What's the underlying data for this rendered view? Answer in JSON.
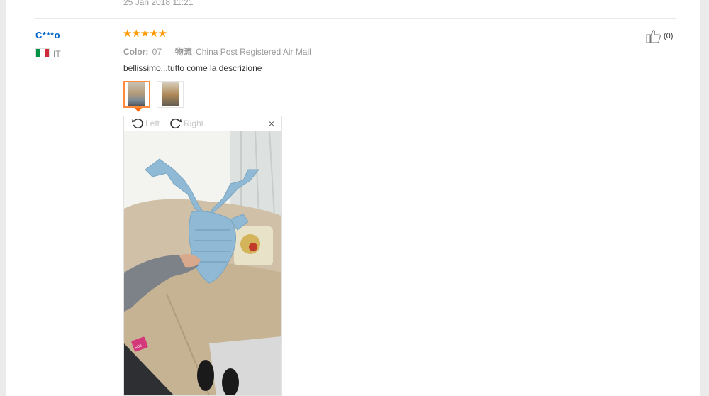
{
  "previous_review": {
    "date": "25 Jan 2018 11:21"
  },
  "review": {
    "username": "C***o",
    "country": "IT",
    "rating": 5,
    "stars_text": "★★★★★",
    "color_label": "Color:",
    "color_value": "07",
    "shipping_label": "物流",
    "shipping_value": "China Post Registered Air Mail",
    "text": "bellissimo...tutto come la descrizione",
    "like_count": "(0)"
  },
  "viewer": {
    "rotate_left_label": "Left",
    "rotate_right_label": "Right",
    "close_symbol": "×",
    "photo_sticker": "SOS"
  },
  "colors": {
    "username": "#0066cc",
    "stars": "#ff9900",
    "selected_thumb_border": "#ff8a3d",
    "flag_green": "#009246",
    "flag_white": "#ffffff",
    "flag_red": "#ce2b37"
  },
  "icons": [
    "flag-it-icon",
    "star-icon",
    "thumbs-up-icon",
    "rotate-left-icon",
    "rotate-right-icon",
    "close-icon"
  ]
}
